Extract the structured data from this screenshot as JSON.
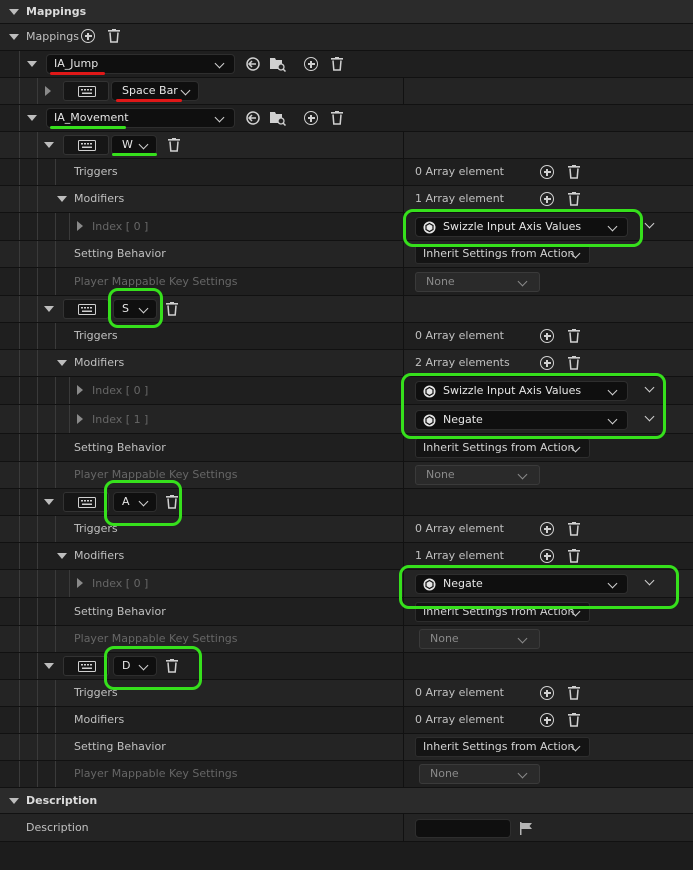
{
  "header": {
    "title": "Mappings"
  },
  "mappings": {
    "label": "Mappings"
  },
  "actions": [
    {
      "name": "IA_Jump",
      "key": "Space Bar"
    },
    {
      "name": "IA_Movement"
    }
  ],
  "movement_keys": [
    {
      "key": "W",
      "triggers_label": "Triggers",
      "triggers_value": "0 Array element",
      "modifiers_label": "Modifiers",
      "modifiers_value": "1 Array element",
      "modifier_items": [
        {
          "index": "Index [ 0 ]",
          "value": "Swizzle Input Axis Values"
        }
      ],
      "setting_label": "Setting Behavior",
      "setting_value": "Inherit Settings from Action",
      "player_label": "Player Mappable Key Settings",
      "player_value": "None"
    },
    {
      "key": "S",
      "triggers_label": "Triggers",
      "triggers_value": "0 Array element",
      "modifiers_label": "Modifiers",
      "modifiers_value": "2 Array elements",
      "modifier_items": [
        {
          "index": "Index [ 0 ]",
          "value": "Swizzle Input Axis Values"
        },
        {
          "index": "Index [ 1 ]",
          "value": "Negate"
        }
      ],
      "setting_label": "Setting Behavior",
      "setting_value": "Inherit Settings from Action",
      "player_label": "Player Mappable Key Settings",
      "player_value": "None"
    },
    {
      "key": "A",
      "triggers_label": "Triggers",
      "triggers_value": "0 Array element",
      "modifiers_label": "Modifiers",
      "modifiers_value": "1 Array element",
      "modifier_items": [
        {
          "index": "Index [ 0 ]",
          "value": "Negate"
        }
      ],
      "setting_label": "Setting Behavior",
      "setting_value": "Inherit Settings from Action",
      "player_label": "Player Mappable Key Settings",
      "player_value": "None"
    },
    {
      "key": "D",
      "triggers_label": "Triggers",
      "triggers_value": "0 Array element",
      "modifiers_label": "Modifiers",
      "modifiers_value": "0 Array element",
      "modifier_items": [],
      "setting_label": "Setting Behavior",
      "setting_value": "Inherit Settings from Action",
      "player_label": "Player Mappable Key Settings",
      "player_value": "None"
    }
  ],
  "description": {
    "header": "Description",
    "label": "Description",
    "value": ""
  },
  "colors": {
    "annotation_red": "#e01818",
    "annotation_green": "#36e01c",
    "panel_bg": "#242424"
  },
  "icons": [
    "chevron-down-icon",
    "plus-circle-icon",
    "trash-icon",
    "keyboard-icon",
    "reset-arrow-icon",
    "browse-folder-icon",
    "modifier-hex-icon",
    "flag-icon"
  ]
}
